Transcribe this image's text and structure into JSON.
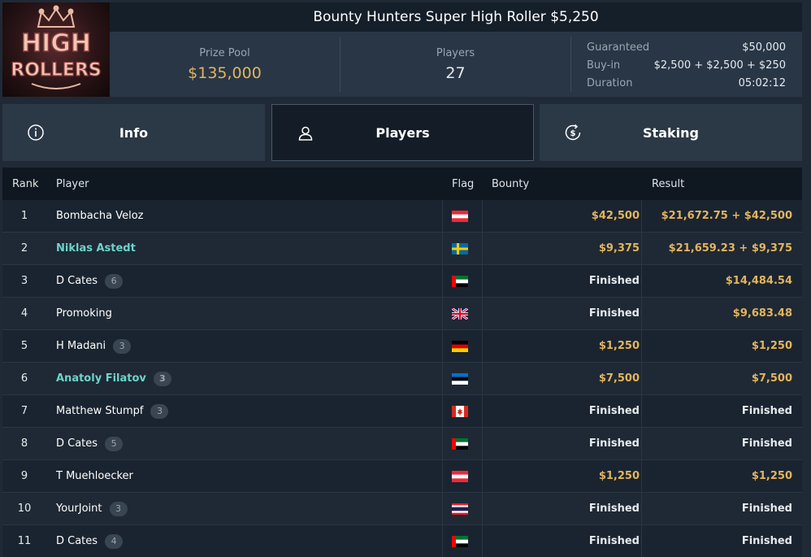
{
  "logo": {
    "line1": "HIGH",
    "line2": "ROLLERS"
  },
  "tournament": {
    "title": "Bounty Hunters Super High Roller $5,250"
  },
  "stats": {
    "prize_pool_label": "Prize Pool",
    "prize_pool_value": "$135,000",
    "players_label": "Players",
    "players_value": "27",
    "guaranteed_label": "Guaranteed",
    "guaranteed_value": "$50,000",
    "buyin_label": "Buy-in",
    "buyin_value": "$2,500 + $2,500 + $250",
    "duration_label": "Duration",
    "duration_value": "05:02:12"
  },
  "tabs": [
    {
      "label": "Info",
      "icon": "info-icon"
    },
    {
      "label": "Players",
      "icon": "user-icon",
      "active": true
    },
    {
      "label": "Staking",
      "icon": "dollar-icon"
    }
  ],
  "table": {
    "headers": {
      "rank": "Rank",
      "player": "Player",
      "flag": "Flag",
      "bounty": "Bounty",
      "result": "Result"
    },
    "rows": [
      {
        "rank": "1",
        "player": "Bombacha Veloz",
        "badge": "",
        "flag": "austria-flag",
        "bounty": "$42,500",
        "result": "$21,672.75 + $42,500"
      },
      {
        "rank": "2",
        "player": "Niklas Astedt",
        "badge": "",
        "flag": "sweden-flag",
        "bounty": "$9,375",
        "result": "$21,659.23 + $9,375"
      },
      {
        "rank": "3",
        "player": "D Cates",
        "badge": "6",
        "flag": "uae-flag",
        "bounty": "Finished",
        "result": "$14,484.54"
      },
      {
        "rank": "4",
        "player": "Promoking",
        "badge": "",
        "flag": "uk-flag",
        "bounty": "Finished",
        "result": "$9,683.48"
      },
      {
        "rank": "5",
        "player": "H Madani",
        "badge": "3",
        "flag": "germany-flag",
        "bounty": "$1,250",
        "result": "$1,250"
      },
      {
        "rank": "6",
        "player": "Anatoly Filatov",
        "badge": "3",
        "flag": "estonia-flag",
        "bounty": "$7,500",
        "result": "$7,500"
      },
      {
        "rank": "7",
        "player": "Matthew Stumpf",
        "badge": "3",
        "flag": "canada-flag",
        "bounty": "Finished",
        "result": "Finished"
      },
      {
        "rank": "8",
        "player": "D Cates",
        "badge": "5",
        "flag": "uae-flag",
        "bounty": "Finished",
        "result": "Finished"
      },
      {
        "rank": "9",
        "player": "T Muehloecker",
        "badge": "",
        "flag": "austria-flag",
        "bounty": "$1,250",
        "result": "$1,250"
      },
      {
        "rank": "10",
        "player": "YourJoint",
        "badge": "3",
        "flag": "thailand-flag",
        "bounty": "Finished",
        "result": "Finished"
      },
      {
        "rank": "11",
        "player": "D Cates",
        "badge": "4",
        "flag": "uae-flag",
        "bounty": "Finished",
        "result": "Finished"
      }
    ]
  },
  "colors": {
    "gold": "#e4b45c",
    "link": "#6ed3c8",
    "background": "#1f2a36"
  }
}
